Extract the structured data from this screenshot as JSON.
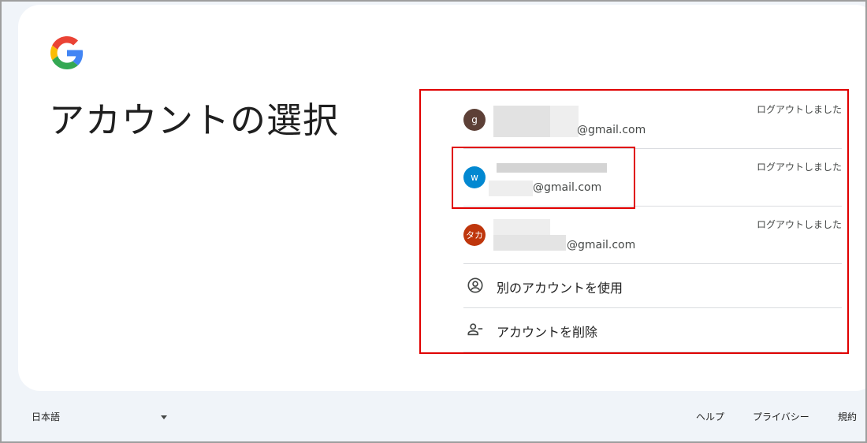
{
  "page": {
    "title": "アカウントの選択"
  },
  "accounts": [
    {
      "avatar_letter": "g",
      "avatar_color": "#5d4037",
      "email_suffix": "@gmail.com",
      "status": "ログアウトしました"
    },
    {
      "avatar_letter": "w",
      "avatar_color": "#0288d1",
      "email_suffix": "@gmail.com",
      "status": "ログアウトしました"
    },
    {
      "avatar_letter": "タカ",
      "avatar_color": "#bf360c",
      "email_suffix": "@gmail.com",
      "status": "ログアウトしました"
    }
  ],
  "actions": {
    "use_another": {
      "label": "別のアカウントを使用",
      "icon": "account-circle-icon"
    },
    "remove": {
      "label": "アカウントを削除",
      "icon": "person-remove-icon"
    }
  },
  "footer": {
    "language": "日本語",
    "help": "ヘルプ",
    "privacy": "プライバシー",
    "terms": "規約"
  },
  "colors": {
    "highlight": "#e00000",
    "background": "#f0f4f9",
    "card": "#ffffff"
  }
}
